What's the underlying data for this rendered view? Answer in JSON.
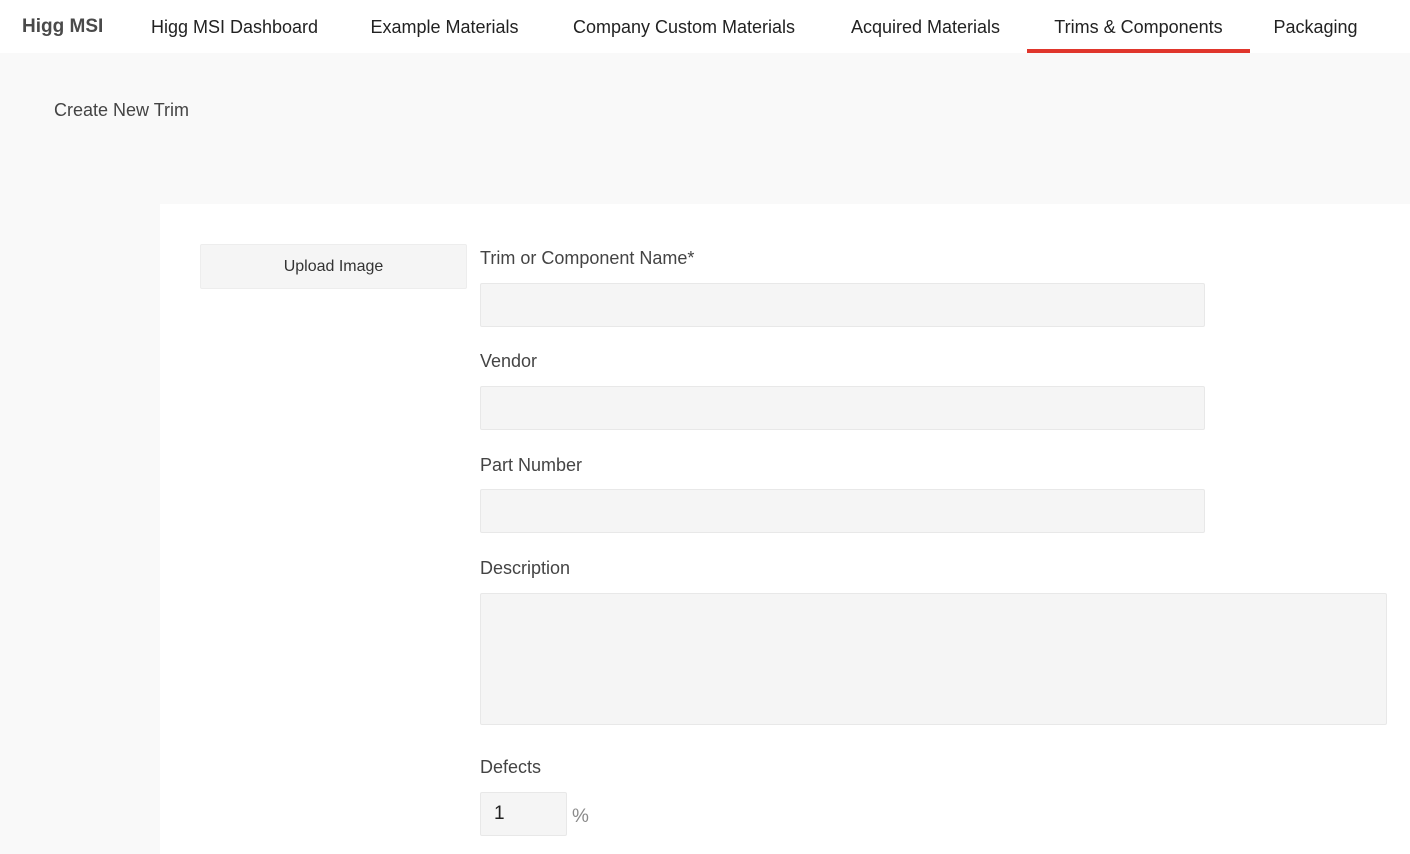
{
  "nav": {
    "brand": "Higg MSI",
    "tabs": [
      {
        "label": "Higg MSI Dashboard"
      },
      {
        "label": "Example Materials"
      },
      {
        "label": "Company Custom Materials"
      },
      {
        "label": "Acquired Materials"
      },
      {
        "label": "Trims & Components",
        "active": true
      },
      {
        "label": "Packaging"
      }
    ],
    "active_color": "#e0362c"
  },
  "page": {
    "title": "Create New Trim"
  },
  "form": {
    "upload_label": "Upload Image",
    "name_label": "Trim or Component Name*",
    "name_value": "",
    "vendor_label": "Vendor",
    "vendor_value": "",
    "part_number_label": "Part Number",
    "part_number_value": "",
    "description_label": "Description",
    "description_value": "",
    "defects_label": "Defects",
    "defects_value": "1",
    "defects_unit": "%"
  }
}
